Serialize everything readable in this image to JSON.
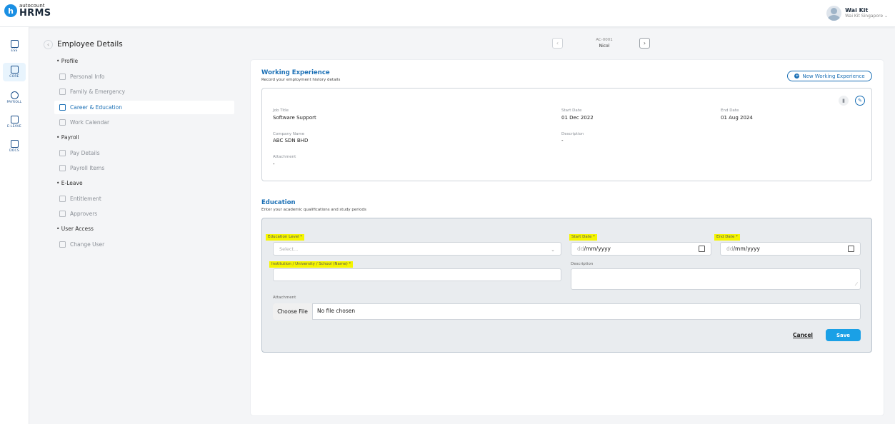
{
  "brand": {
    "sub": "autocount",
    "name": "HRMS",
    "mark": "h"
  },
  "user": {
    "name": "Wai Kit",
    "company": "Wai Kit Singapore ⌄"
  },
  "rail": [
    {
      "label": "ESS",
      "icon": "ess-icon"
    },
    {
      "label": "CORE",
      "icon": "core-icon"
    },
    {
      "label": "PAYROLL",
      "icon": "payroll-icon"
    },
    {
      "label": "E-LEAVE",
      "icon": "e-leave-icon"
    },
    {
      "label": "DOCS",
      "icon": "docs-icon"
    }
  ],
  "page": {
    "title": "Employee Details",
    "back_glyph": "‹"
  },
  "nav": {
    "profile": "• Profile",
    "personal_info": "Personal Info",
    "family": "Family & Emergency",
    "career": "Career & Education",
    "work_calendar": "Work Calendar",
    "payroll": "• Payroll",
    "pay_details": "Pay Details",
    "payroll_items": "Payroll Items",
    "eleave": "• E-Leave",
    "entitlement": "Entitlement",
    "approvers": "Approvers",
    "user_access": "• User Access",
    "change_user": "Change User"
  },
  "record": {
    "code": "AC-0001",
    "name": "Nicol",
    "prev": "‹",
    "next": "›"
  },
  "working_experience": {
    "title": "Working Experience",
    "subtitle": "Record your employment history details",
    "new_button": "New Working Experience",
    "new_icon": "+",
    "entry": {
      "job_title_label": "Job Title",
      "job_title": "Software Support",
      "start_date_label": "Start Date",
      "start_date": "01 Dec 2022",
      "end_date_label": "End Date",
      "end_date": "01 Aug 2024",
      "company_label": "Company Name",
      "company": "ABC SDN BHD",
      "description_label": "Description",
      "description": "-",
      "attachment_label": "Attachment",
      "attachment": "-"
    }
  },
  "education": {
    "title": "Education",
    "subtitle": "Enter your academic qualifications and study periods",
    "level_label": "Education Level *",
    "level_placeholder": "Select...",
    "start_label": "Start Date *",
    "end_label": "End Date *",
    "date_dd": "dd",
    "date_rest": "/mm/yyyy",
    "institution_label": "Institution / University / School (Name) *",
    "description_label": "Description",
    "attachment_label": "Attachment",
    "choose_file": "Choose File",
    "no_file": "No file chosen",
    "cancel": "Cancel",
    "save": "Save"
  },
  "colors": {
    "accent": "#1a6fb5",
    "save": "#1aa0e6",
    "highlight": "#f5f500"
  }
}
